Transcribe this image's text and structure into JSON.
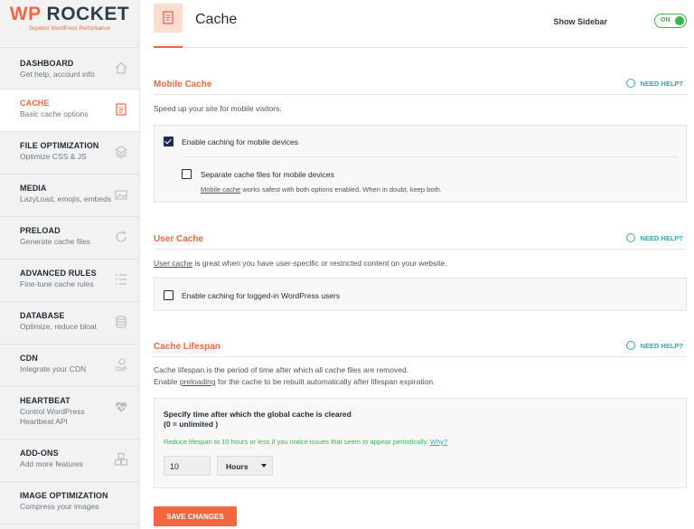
{
  "brand": {
    "logo_prefix": "WP",
    "logo_suffix": " ROCKET",
    "tagline": "Superior WordPress Performance",
    "accent": "#f56640",
    "help_color": "#40a2b7",
    "success_color": "#39b54a"
  },
  "sidebar": {
    "items": [
      {
        "title": "DASHBOARD",
        "sub": "Get help, account info",
        "icon": "home-icon"
      },
      {
        "title": "CACHE",
        "sub": "Basic cache options",
        "icon": "document-icon",
        "active": true
      },
      {
        "title": "FILE OPTIMIZATION",
        "sub": "Optimize CSS & JS",
        "icon": "layers-icon"
      },
      {
        "title": "MEDIA",
        "sub": "LazyLoad, emojis, embeds",
        "icon": "image-icon"
      },
      {
        "title": "PRELOAD",
        "sub": "Generate cache files",
        "icon": "refresh-icon"
      },
      {
        "title": "ADVANCED RULES",
        "sub": "Fine-tune cache rules",
        "icon": "list-icon"
      },
      {
        "title": "DATABASE",
        "sub": "Optimize, reduce bloat",
        "icon": "database-icon"
      },
      {
        "title": "CDN",
        "sub": "Integrate your CDN",
        "icon": "cdn-hand-icon"
      },
      {
        "title": "HEARTBEAT",
        "sub": "Control WordPress Heartbeat API",
        "icon": "heartbeat-icon"
      },
      {
        "title": "ADD-ONS",
        "sub": "Add more features",
        "icon": "cubes-icon"
      },
      {
        "title": "IMAGE OPTIMIZATION",
        "sub": "Compress your images",
        "icon": ""
      }
    ]
  },
  "header": {
    "title": "Cache",
    "show_sidebar_label": "Show Sidebar",
    "toggle_label": "ON"
  },
  "need_help_label": "NEED HELP?",
  "mobile_cache": {
    "title": "Mobile Cache",
    "description": "Speed up your site for mobile visitors.",
    "enable_label": "Enable caching for mobile devices",
    "enable_checked": true,
    "separate_label": "Separate cache files for mobile devices",
    "separate_checked": false,
    "separate_note_link": "Mobile cache",
    "separate_note_rest": " works safest with both options enabled. When in doubt, keep both."
  },
  "user_cache": {
    "title": "User Cache",
    "description_link": "User cache",
    "description_rest": " is great when you have user-specific or restricted content on your website.",
    "enable_label": "Enable caching for logged-in WordPress users",
    "enable_checked": false
  },
  "cache_lifespan": {
    "title": "Cache Lifespan",
    "description_line1": "Cache lifespan is the period of time after which all cache files are removed.",
    "description_line2_pre": "Enable ",
    "description_line2_link": "preloading",
    "description_line2_post": " for the cache to be rebuilt automatically after lifespan expiration.",
    "field_title_line1": "Specify time after which the global cache is cleared",
    "field_title_line2": "(0 = unlimited )",
    "note": "Reduce lifespan to 10 hours or less if you notice issues that seem to appear periodically. ",
    "note_link": "Why?",
    "value": "10",
    "unit": "Hours"
  },
  "save_button": "SAVE CHANGES"
}
